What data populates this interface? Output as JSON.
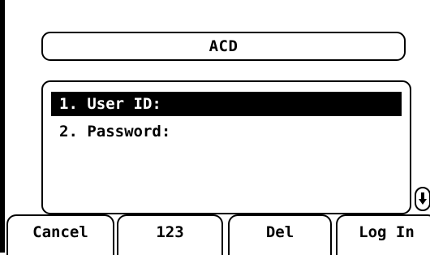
{
  "title": "ACD",
  "menu": {
    "items": [
      {
        "label": "1. User ID:",
        "selected": true
      },
      {
        "label": "2. Password:",
        "selected": false
      }
    ]
  },
  "scroll": {
    "icon": "scroll-down-icon"
  },
  "softkeys": [
    {
      "label": "Cancel"
    },
    {
      "label": "123"
    },
    {
      "label": "Del"
    },
    {
      "label": "Log In"
    }
  ],
  "colors": {
    "background": "#ffffff",
    "foreground": "#000000",
    "highlight": "#000000"
  }
}
